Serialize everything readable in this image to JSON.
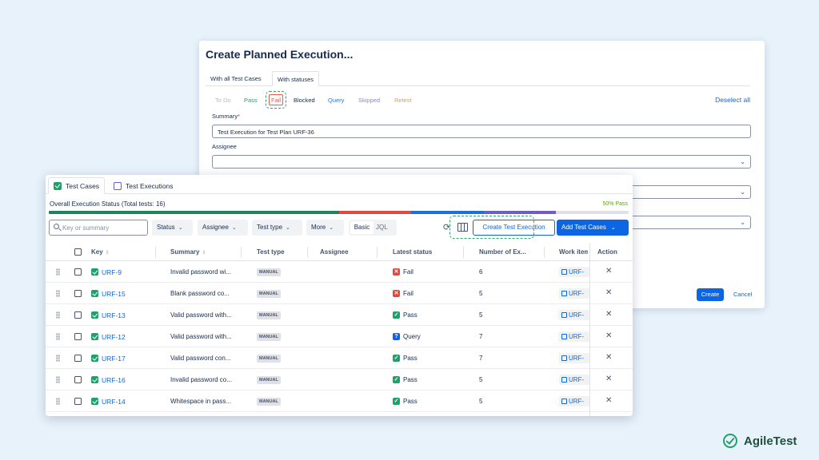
{
  "modal": {
    "title": "Create Planned Execution...",
    "tabs": [
      "With all Test Cases",
      "With statuses"
    ],
    "status_filters": [
      {
        "label": "To Do",
        "color": "#b3b9c4"
      },
      {
        "label": "Pass",
        "color": "#22a06b"
      },
      {
        "label": "Fail",
        "color": "#e85c4a"
      },
      {
        "label": "Blocked",
        "color": "#172b4d"
      },
      {
        "label": "Query",
        "color": "#1d7afc"
      },
      {
        "label": "Skipped",
        "color": "#8f7ee7"
      },
      {
        "label": "Retest",
        "color": "#e2a03f"
      }
    ],
    "deselect_all": "Deselect all",
    "summary_label": "Summary",
    "summary_required": "*",
    "summary_value": "Test Execution for Test Plan URF-36",
    "assignee_label": "Assignee",
    "create": "Create",
    "cancel": "Cancel"
  },
  "panel": {
    "tabs": [
      "Test Cases",
      "Test Executions"
    ],
    "overall_status": "Overall Execution Status (Total tests: 16)",
    "pass_percent": "50% Pass",
    "progress": [
      {
        "status": "Pass",
        "fraction": 0.5,
        "color": "#1f845a"
      },
      {
        "status": "Fail",
        "fraction": 0.125,
        "color": "#e2483d"
      },
      {
        "status": "Query",
        "fraction": 0.125,
        "color": "#1d6fe0"
      },
      {
        "status": "Other",
        "fraction": 0.125,
        "color": "#6e5dc6"
      }
    ],
    "search_placeholder": "Key or summary",
    "filters": [
      "Status",
      "Assignee",
      "Test type",
      "More"
    ],
    "mode_basic": "Basic",
    "mode_jql": "JQL",
    "create_execution": "Create Test Execution",
    "add_test_cases": "Add Test Cases",
    "columns": [
      "Key",
      "Summary",
      "Test type",
      "Assignee",
      "Latest status",
      "Number of Ex...",
      "Work item",
      "Action"
    ],
    "rows": [
      {
        "key": "URF-9",
        "summary": "Invalid password wi...",
        "type": "MANUAL",
        "status": "Fail",
        "status_color": "#e2483d",
        "status_icon": "✕",
        "count": "6",
        "work": "URF-"
      },
      {
        "key": "URF-15",
        "summary": "Blank password co...",
        "type": "MANUAL",
        "status": "Fail",
        "status_color": "#e2483d",
        "status_icon": "✕",
        "count": "5",
        "work": "URF-"
      },
      {
        "key": "URF-13",
        "summary": "Valid password with...",
        "type": "MANUAL",
        "status": "Pass",
        "status_color": "#22a06b",
        "status_icon": "✓",
        "count": "5",
        "work": "URF-"
      },
      {
        "key": "URF-12",
        "summary": "Valid password with...",
        "type": "MANUAL",
        "status": "Query",
        "status_color": "#0c66e4",
        "status_icon": "?",
        "count": "7",
        "work": "URF-"
      },
      {
        "key": "URF-17",
        "summary": "Valid password con...",
        "type": "MANUAL",
        "status": "Pass",
        "status_color": "#22a06b",
        "status_icon": "✓",
        "count": "7",
        "work": "URF-"
      },
      {
        "key": "URF-16",
        "summary": "Invalid password co...",
        "type": "MANUAL",
        "status": "Pass",
        "status_color": "#22a06b",
        "status_icon": "✓",
        "count": "5",
        "work": "URF-"
      },
      {
        "key": "URF-14",
        "summary": "Whitespace in pass...",
        "type": "MANUAL",
        "status": "Pass",
        "status_color": "#22a06b",
        "status_icon": "✓",
        "count": "5",
        "work": "URF-"
      }
    ]
  },
  "brand": {
    "name": "AgileTest"
  }
}
